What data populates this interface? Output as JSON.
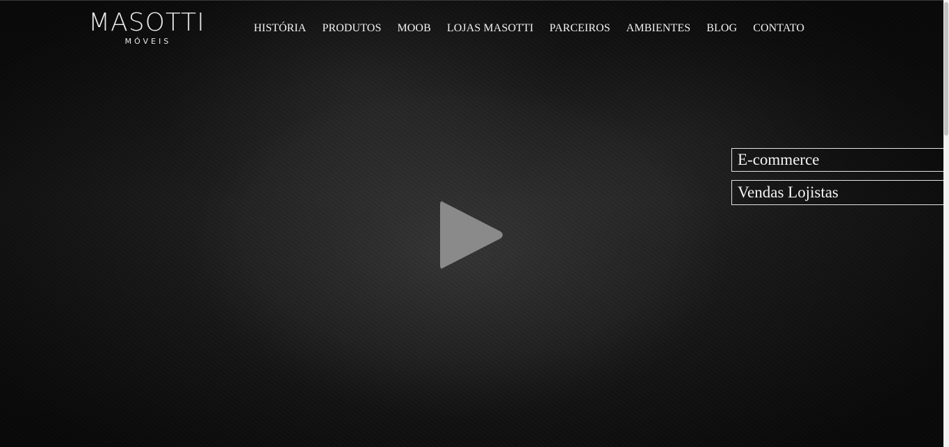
{
  "brand": {
    "name": "MASOTTI",
    "tagline": "MÓVEIS"
  },
  "nav": {
    "items": [
      {
        "label": "HISTÓRIA"
      },
      {
        "label": "PRODUTOS"
      },
      {
        "label": "MOOB"
      },
      {
        "label": "LOJAS MASOTTI"
      },
      {
        "label": "PARCEIROS"
      },
      {
        "label": "AMBIENTES"
      },
      {
        "label": "BLOG"
      },
      {
        "label": "CONTATO"
      }
    ]
  },
  "side_links": {
    "ecommerce": "E-commerce",
    "vendas": "Vendas Lojistas"
  },
  "hero": {
    "play_icon": "play-icon"
  },
  "colors": {
    "background": "#1a1a1a",
    "text": "#f2f2f2",
    "play": "#8a8a8a"
  }
}
